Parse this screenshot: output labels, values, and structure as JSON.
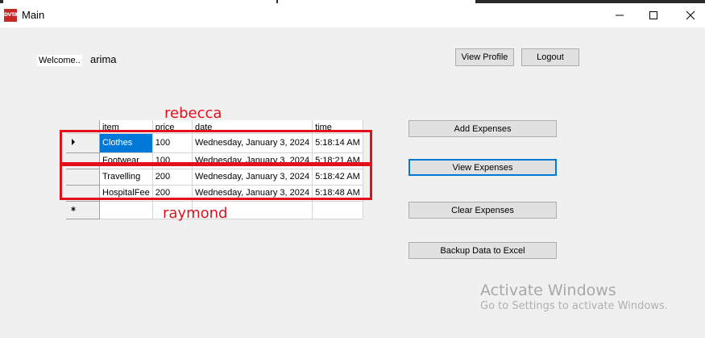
{
  "window": {
    "icon_text": "DVTA",
    "title": "Main"
  },
  "header": {
    "welcome_label": "Welcome..",
    "username": "arima",
    "view_profile_label": "View Profile",
    "logout_label": "Logout"
  },
  "grid": {
    "columns": [
      "item",
      "price",
      "date",
      "time"
    ],
    "rows": [
      {
        "item": "Clothes",
        "price": "100",
        "date": "Wednesday, January 3, 2024",
        "time": "5:18:14 AM"
      },
      {
        "item": "Footwear",
        "price": "100",
        "date": "Wednesday, January 3, 2024",
        "time": "5:18:21 AM"
      },
      {
        "item": "Travelling",
        "price": "200",
        "date": "Wednesday, January 3, 2024",
        "time": "5:18:42 AM"
      },
      {
        "item": "HospitalFee",
        "price": "200",
        "date": "Wednesday, January 3, 2024",
        "time": "5:18:48 AM"
      }
    ]
  },
  "annotations": {
    "top_label": "rebecca",
    "bottom_label": "raymond",
    "color": "#e3101b"
  },
  "actions": {
    "add_label": "Add  Expenses",
    "view_label": "View Expenses",
    "clear_label": "Clear Expenses",
    "backup_label": "Backup Data to Excel"
  },
  "watermark": {
    "line1": "Activate Windows",
    "line2": "Go to Settings to activate Windows."
  },
  "colors": {
    "selection": "#0078d7",
    "focus_border": "#0078d7",
    "window_bg": "#f0f0f0"
  }
}
